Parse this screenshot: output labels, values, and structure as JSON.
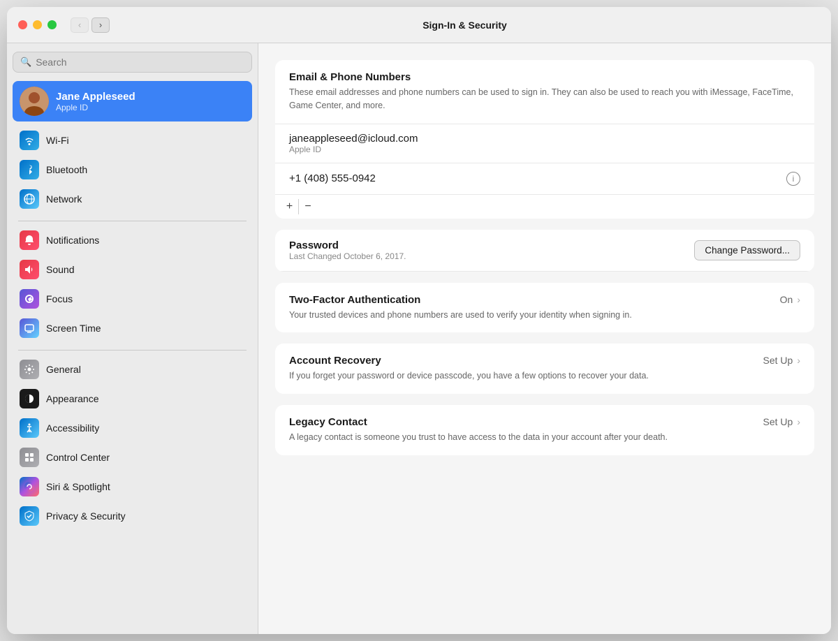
{
  "window": {
    "title": "Sign-In & Security"
  },
  "titlebar": {
    "back_btn": "‹",
    "forward_btn": "›"
  },
  "sidebar": {
    "search_placeholder": "Search",
    "user": {
      "name": "Jane Appleseed",
      "subtitle": "Apple ID"
    },
    "items": [
      {
        "id": "wifi",
        "label": "Wi-Fi",
        "icon_class": "icon-wifi",
        "icon": "📶"
      },
      {
        "id": "bluetooth",
        "label": "Bluetooth",
        "icon_class": "icon-bluetooth",
        "icon": "🔷"
      },
      {
        "id": "network",
        "label": "Network",
        "icon_class": "icon-network",
        "icon": "🌐"
      },
      {
        "id": "notifications",
        "label": "Notifications",
        "icon_class": "icon-notifications",
        "icon": "🔔"
      },
      {
        "id": "sound",
        "label": "Sound",
        "icon_class": "icon-sound",
        "icon": "🔊"
      },
      {
        "id": "focus",
        "label": "Focus",
        "icon_class": "icon-focus",
        "icon": "🌙"
      },
      {
        "id": "screentime",
        "label": "Screen Time",
        "icon_class": "icon-screentime",
        "icon": "⏱"
      },
      {
        "id": "general",
        "label": "General",
        "icon_class": "icon-general",
        "icon": "⚙️"
      },
      {
        "id": "appearance",
        "label": "Appearance",
        "icon_class": "icon-appearance",
        "icon": "◑"
      },
      {
        "id": "accessibility",
        "label": "Accessibility",
        "icon_class": "icon-accessibility",
        "icon": "♿"
      },
      {
        "id": "controlcenter",
        "label": "Control Center",
        "icon_class": "icon-controlcenter",
        "icon": "⊞"
      },
      {
        "id": "siri",
        "label": "Siri & Spotlight",
        "icon_class": "icon-siri",
        "icon": "🌈"
      },
      {
        "id": "privacy",
        "label": "Privacy & Security",
        "icon_class": "icon-privacy",
        "icon": "✋"
      }
    ]
  },
  "detail": {
    "email_section": {
      "title": "Email & Phone Numbers",
      "description": "These email addresses and phone numbers can be used to sign in. They can also be used to reach you with iMessage, FaceTime, Game Center, and more.",
      "email": "janeappleseed@icloud.com",
      "email_label": "Apple ID",
      "phone": "+1 (408) 555-0942",
      "add_btn": "+",
      "remove_btn": "−"
    },
    "password_section": {
      "title": "Password",
      "subtitle": "Last Changed October 6, 2017.",
      "change_btn": "Change Password..."
    },
    "tfa_section": {
      "title": "Two-Factor Authentication",
      "status": "On",
      "description": "Your trusted devices and phone numbers are used to verify your identity when signing in."
    },
    "recovery_section": {
      "title": "Account Recovery",
      "action": "Set Up",
      "description": "If you forget your password or device passcode, you have a few options to recover your data."
    },
    "legacy_section": {
      "title": "Legacy Contact",
      "action": "Set Up",
      "description": "A legacy contact is someone you trust to have access to the data in your account after your death."
    }
  }
}
